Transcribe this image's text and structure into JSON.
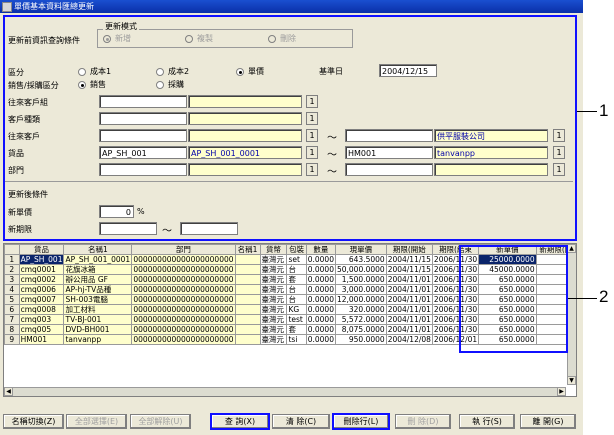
{
  "window": {
    "title": "單價基本資料匯總更新"
  },
  "criteria": {
    "query_label": "更新前資訊查詢條件",
    "update_mode": {
      "title": "更新模式",
      "options": [
        "新增",
        "複製",
        "刪除"
      ],
      "selected": "新增"
    },
    "category_label": "區分",
    "category_options": [
      "成本1",
      "成本2",
      "單價"
    ],
    "category_selected": "單價",
    "base_date_label": "基準日",
    "base_date_value": "2004/12/15",
    "sales_label": "銷售/採購區分",
    "sales_options": [
      "銷售",
      "採購"
    ],
    "sales_selected": "銷售",
    "rows": [
      {
        "label": "往來客戶組",
        "code": "",
        "name": ""
      },
      {
        "label": "客戶種類",
        "code": "",
        "name": ""
      },
      {
        "label": "往來客戶",
        "code": "",
        "name": "",
        "code2": "",
        "name2": "供平服裝公司"
      },
      {
        "label": "貨品",
        "code": "AP_SH_001",
        "name": "AP_SH_001_0001",
        "code2": "HM001",
        "name2": "tanvanpp"
      },
      {
        "label": "部門",
        "code": "",
        "name": "",
        "code2": "",
        "name2": ""
      }
    ],
    "ellipsis": "1",
    "tilde": "～",
    "after_label": "更新後條件",
    "new_price_label": "新單價",
    "new_price_value": "0",
    "new_price_unit": "%",
    "new_period_label": "新期限",
    "new_period_from": "",
    "new_period_to": ""
  },
  "grid": {
    "columns": [
      "",
      "貨品",
      "名稱1",
      "部門",
      "名稱1",
      "貨幣",
      "包裝",
      "數量",
      "現單價",
      "期限(開始",
      "期限(結束",
      "新單價",
      "新期限(開"
    ],
    "rows": [
      {
        "no": "1",
        "item": "AP_SH_001",
        "name": "AP_SH_001_0001",
        "dept": "000000000000000000000",
        "dname": "",
        "currency": "臺灣元",
        "pack": "set",
        "qty": "0.0000",
        "price": "643.5000",
        "start": "2004/11/15",
        "end": "2006/11/30",
        "new_price": "25000.0000",
        "new_start": ""
      },
      {
        "no": "2",
        "item": "cmq0001",
        "name": "花旗冰箱",
        "dept": "000000000000000000000",
        "dname": "",
        "currency": "臺灣元",
        "pack": "台",
        "qty": "0.0000",
        "price": "50,000.0000",
        "start": "2004/11/15",
        "end": "2006/11/30",
        "new_price": "45000.0000",
        "new_start": ""
      },
      {
        "no": "3",
        "item": "cmq0002",
        "name": "辦公用品 GF",
        "dept": "000000000000000000000",
        "dname": "",
        "currency": "臺灣元",
        "pack": "套",
        "qty": "0.0000",
        "price": "1,500.0000",
        "start": "2004/11/01",
        "end": "2006/11/30",
        "new_price": "650.0000",
        "new_start": ""
      },
      {
        "no": "4",
        "item": "cmq0006",
        "name": "AP-hj-TV品種",
        "dept": "000000000000000000000",
        "dname": "",
        "currency": "臺灣元",
        "pack": "台",
        "qty": "0.0000",
        "price": "3,000.0000",
        "start": "2004/11/01",
        "end": "2006/11/30",
        "new_price": "650.0000",
        "new_start": ""
      },
      {
        "no": "5",
        "item": "cmq0007",
        "name": "SH-003電腦",
        "dept": "000000000000000000000",
        "dname": "",
        "currency": "臺灣元",
        "pack": "台",
        "qty": "0.0000",
        "price": "12,000.0000",
        "start": "2004/11/01",
        "end": "2006/11/30",
        "new_price": "650.0000",
        "new_start": ""
      },
      {
        "no": "6",
        "item": "cmq0008",
        "name": "加工材料",
        "dept": "000000000000000000000",
        "dname": "",
        "currency": "臺灣元",
        "pack": "KG",
        "qty": "0.0000",
        "price": "320.0000",
        "start": "2004/11/01",
        "end": "2006/11/30",
        "new_price": "650.0000",
        "new_start": ""
      },
      {
        "no": "7",
        "item": "cmq003",
        "name": "TV-BJ-001",
        "dept": "000000000000000000000",
        "dname": "",
        "currency": "臺灣元",
        "pack": "test",
        "qty": "0.0000",
        "price": "5,572.0000",
        "start": "2004/11/01",
        "end": "2006/11/30",
        "new_price": "650.0000",
        "new_start": ""
      },
      {
        "no": "8",
        "item": "cmq005",
        "name": "DVD-BH001",
        "dept": "000000000000000000000",
        "dname": "",
        "currency": "臺灣元",
        "pack": "套",
        "qty": "0.0000",
        "price": "8,075.0000",
        "start": "2004/11/01",
        "end": "2006/11/30",
        "new_price": "650.0000",
        "new_start": ""
      },
      {
        "no": "9",
        "item": "HM001",
        "name": "tanvanpp",
        "dept": "000000000000000000000",
        "dname": "",
        "currency": "臺灣元",
        "pack": "tsi",
        "qty": "0.0000",
        "price": "950.0000",
        "start": "2004/12/08",
        "end": "2006/12/01",
        "new_price": "650.0000",
        "new_start": ""
      }
    ]
  },
  "buttons": {
    "name_switch": "名稱切換(Z)",
    "select_all": "全部選擇(E)",
    "deselect_all": "全部解除(U)",
    "query": "查 詢(X)",
    "clear": "清 除(C)",
    "delete_row": "刪除行(L)",
    "del": "刪 除(D)",
    "execute": "執 行(S)",
    "close": "離 開(G)"
  },
  "callouts": [
    "1",
    "2"
  ],
  "colors": {
    "highlight": "#1010ff",
    "title_bar": "#0a2fa8",
    "yellow_field": "#ffffcc",
    "selected_cell": "#0a246a"
  }
}
